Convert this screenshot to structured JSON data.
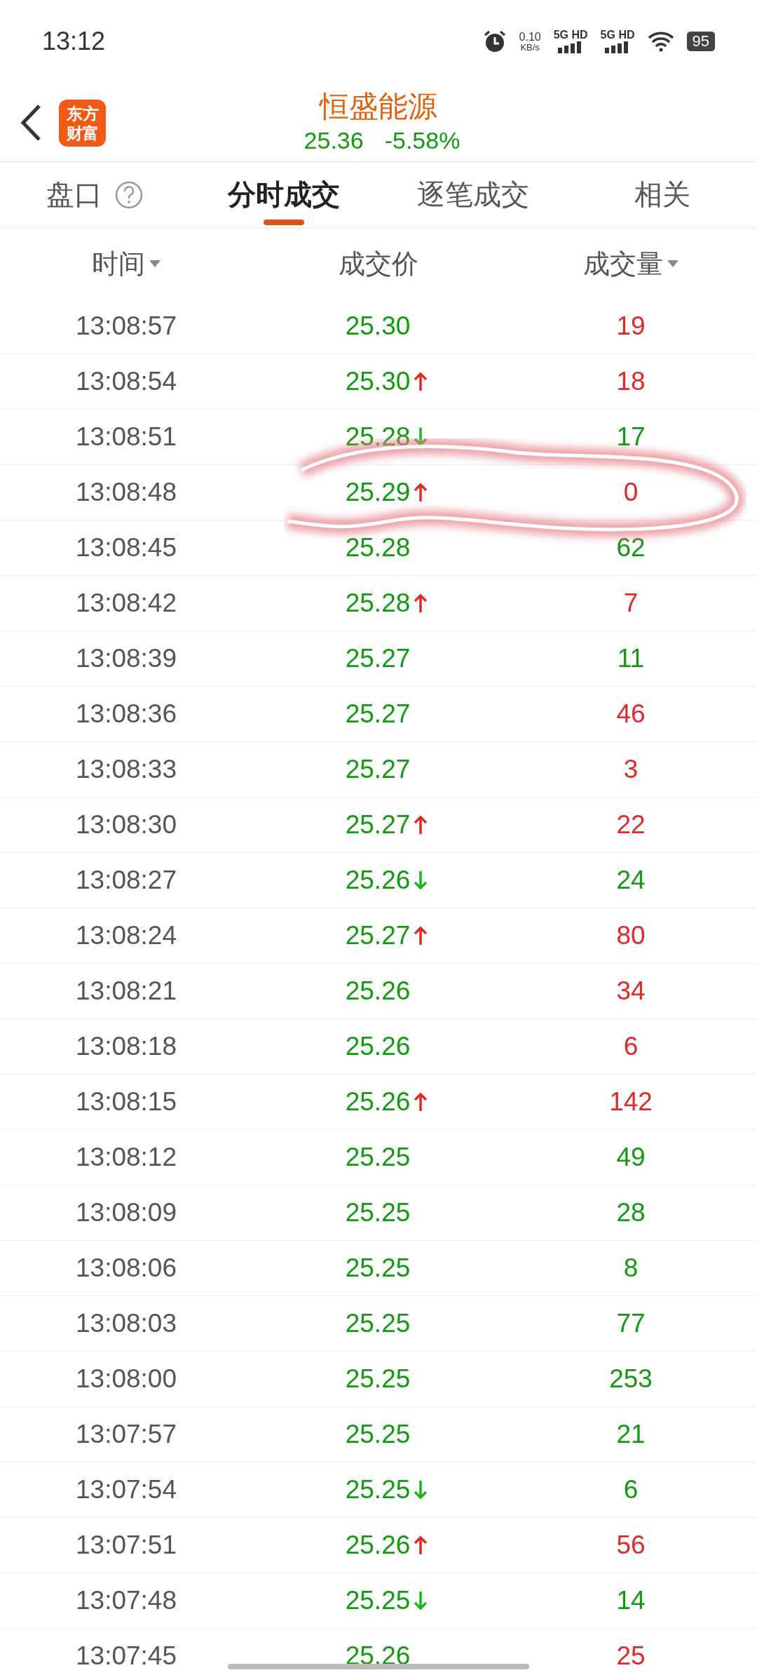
{
  "status_bar": {
    "time": "13:12",
    "speed_value": "0.10",
    "speed_unit": "KB/s",
    "sim1": "5G HD",
    "sim2": "5G HD",
    "battery": "95"
  },
  "header": {
    "logo_line1": "东方",
    "logo_line2": "财富",
    "title": "恒盛能源",
    "price": "25.36",
    "change": "-5.58%"
  },
  "tabs": [
    {
      "label": "盘口",
      "help": true,
      "selected": false
    },
    {
      "label": "分时成交",
      "help": false,
      "selected": true
    },
    {
      "label": "逐笔成交",
      "help": false,
      "selected": false
    },
    {
      "label": "相关",
      "help": false,
      "selected": false
    }
  ],
  "columns": [
    {
      "label": "时间",
      "sortable": true
    },
    {
      "label": "成交价",
      "sortable": false
    },
    {
      "label": "成交量",
      "sortable": true
    }
  ],
  "rows": [
    {
      "time": "13:08:57",
      "price": "25.30",
      "up": false,
      "down": false,
      "volume": "19",
      "color": "#e02a2a"
    },
    {
      "time": "13:08:54",
      "price": "25.30",
      "up": true,
      "down": false,
      "volume": "18",
      "color": "#e02a2a"
    },
    {
      "time": "13:08:51",
      "price": "25.28",
      "up": false,
      "down": true,
      "volume": "17",
      "color": "#129a12"
    },
    {
      "time": "13:08:48",
      "price": "25.29",
      "up": true,
      "down": false,
      "volume": "0",
      "color": "#e02a2a"
    },
    {
      "time": "13:08:45",
      "price": "25.28",
      "up": false,
      "down": false,
      "volume": "62",
      "color": "#129a12"
    },
    {
      "time": "13:08:42",
      "price": "25.28",
      "up": true,
      "down": false,
      "volume": "7",
      "color": "#e02a2a"
    },
    {
      "time": "13:08:39",
      "price": "25.27",
      "up": false,
      "down": false,
      "volume": "11",
      "color": "#129a12"
    },
    {
      "time": "13:08:36",
      "price": "25.27",
      "up": false,
      "down": false,
      "volume": "46",
      "color": "#e02a2a"
    },
    {
      "time": "13:08:33",
      "price": "25.27",
      "up": false,
      "down": false,
      "volume": "3",
      "color": "#e02a2a"
    },
    {
      "time": "13:08:30",
      "price": "25.27",
      "up": true,
      "down": false,
      "volume": "22",
      "color": "#e02a2a"
    },
    {
      "time": "13:08:27",
      "price": "25.26",
      "up": false,
      "down": true,
      "volume": "24",
      "color": "#129a12"
    },
    {
      "time": "13:08:24",
      "price": "25.27",
      "up": true,
      "down": false,
      "volume": "80",
      "color": "#e02a2a"
    },
    {
      "time": "13:08:21",
      "price": "25.26",
      "up": false,
      "down": false,
      "volume": "34",
      "color": "#e02a2a"
    },
    {
      "time": "13:08:18",
      "price": "25.26",
      "up": false,
      "down": false,
      "volume": "6",
      "color": "#e02a2a"
    },
    {
      "time": "13:08:15",
      "price": "25.26",
      "up": true,
      "down": false,
      "volume": "142",
      "color": "#e02a2a"
    },
    {
      "time": "13:08:12",
      "price": "25.25",
      "up": false,
      "down": false,
      "volume": "49",
      "color": "#129a12"
    },
    {
      "time": "13:08:09",
      "price": "25.25",
      "up": false,
      "down": false,
      "volume": "28",
      "color": "#129a12"
    },
    {
      "time": "13:08:06",
      "price": "25.25",
      "up": false,
      "down": false,
      "volume": "8",
      "color": "#129a12"
    },
    {
      "time": "13:08:03",
      "price": "25.25",
      "up": false,
      "down": false,
      "volume": "77",
      "color": "#129a12"
    },
    {
      "time": "13:08:00",
      "price": "25.25",
      "up": false,
      "down": false,
      "volume": "253",
      "color": "#129a12"
    },
    {
      "time": "13:07:57",
      "price": "25.25",
      "up": false,
      "down": false,
      "volume": "21",
      "color": "#129a12"
    },
    {
      "time": "13:07:54",
      "price": "25.25",
      "up": false,
      "down": true,
      "volume": "6",
      "color": "#129a12"
    },
    {
      "time": "13:07:51",
      "price": "25.26",
      "up": true,
      "down": false,
      "volume": "56",
      "color": "#e02a2a"
    },
    {
      "time": "13:07:48",
      "price": "25.25",
      "up": false,
      "down": true,
      "volume": "14",
      "color": "#129a12"
    },
    {
      "time": "13:07:45",
      "price": "25.26",
      "up": false,
      "down": false,
      "volume": "25",
      "color": "#e02a2a"
    }
  ]
}
